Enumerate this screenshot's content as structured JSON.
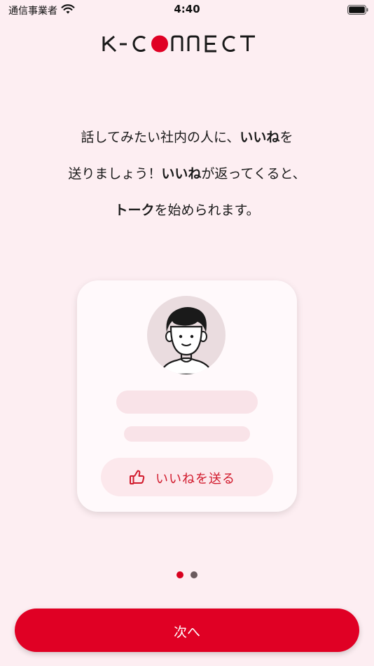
{
  "status_bar": {
    "carrier": "通信事業者",
    "time": "4:40"
  },
  "logo": {
    "text": "K-CONNECT",
    "accent_color": "#e00024"
  },
  "intro": {
    "line1_a": "話してみたい社内の人に、",
    "line1_bold": "いいね",
    "line1_b": "を",
    "line2_a": "送りましょう！",
    "line2_bold": "いいね",
    "line2_b": "が返ってくると、",
    "line3_bold": "トーク",
    "line3_b": "を始められます。"
  },
  "card": {
    "like_button_label": "いいねを送る",
    "like_icon": "thumbs-up-icon",
    "avatar_icon": "person-avatar-icon"
  },
  "pager": {
    "current_page": 1,
    "total_pages": 2,
    "active_color": "#d8001f",
    "inactive_color": "#6b5a5e"
  },
  "next_button": {
    "label": "次へ"
  },
  "colors": {
    "background": "#fdeef2",
    "primary": "#e00024"
  }
}
